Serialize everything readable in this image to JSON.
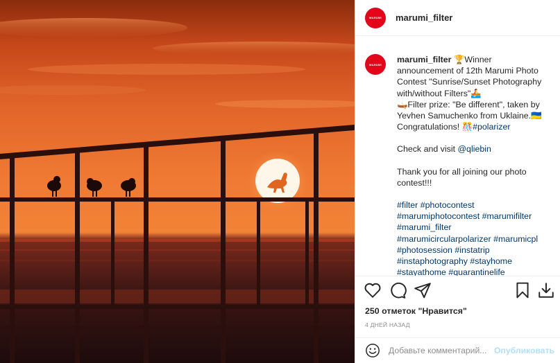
{
  "photo": {
    "alt": "Seagulls on railing at sunset"
  },
  "post": {
    "username": "marumi_filter",
    "avatar_text": "MARUMI",
    "caption": {
      "l1_user": "marumi_filter",
      "l1_text": " 🏆Winner",
      "l2": "announcement of 12th Marumi Photo",
      "l3": "Contest \"Sunrise/Sunset Photography",
      "l4": "with/without Filters\"🚣",
      "l5": "🛶Filter prize: \"Be different\", taken by",
      "l6": "Yevhen Samuchenko from Uklaine.🇺🇦",
      "l7_text": "Congratulations! 🎊",
      "l7_tag": "#polarizer",
      "l8_text": "Check and visit ",
      "l8_link": "@qliebin",
      "l9": "Thank you for all joining our photo",
      "l10": "contest!!!",
      "tags": [
        "#filter #photocontest",
        "#marumiphotocontest #marumifilter",
        "#marumi_filter",
        "#marumicircularpolarizer #marumicpl",
        "#photosession #instatrip",
        "#instaphotography #stayhome",
        "#stayathome #quarantinelife"
      ]
    },
    "likes": "250 отметок \"Нравится\"",
    "date": "4 ДНЕЙ НАЗАД",
    "comment_placeholder": "Добавьте комментарий...",
    "publish_label": "Опубликовать"
  },
  "icons": [
    "heart-icon",
    "comment-icon",
    "share-icon",
    "bookmark-icon",
    "download-icon",
    "smile-icon"
  ]
}
